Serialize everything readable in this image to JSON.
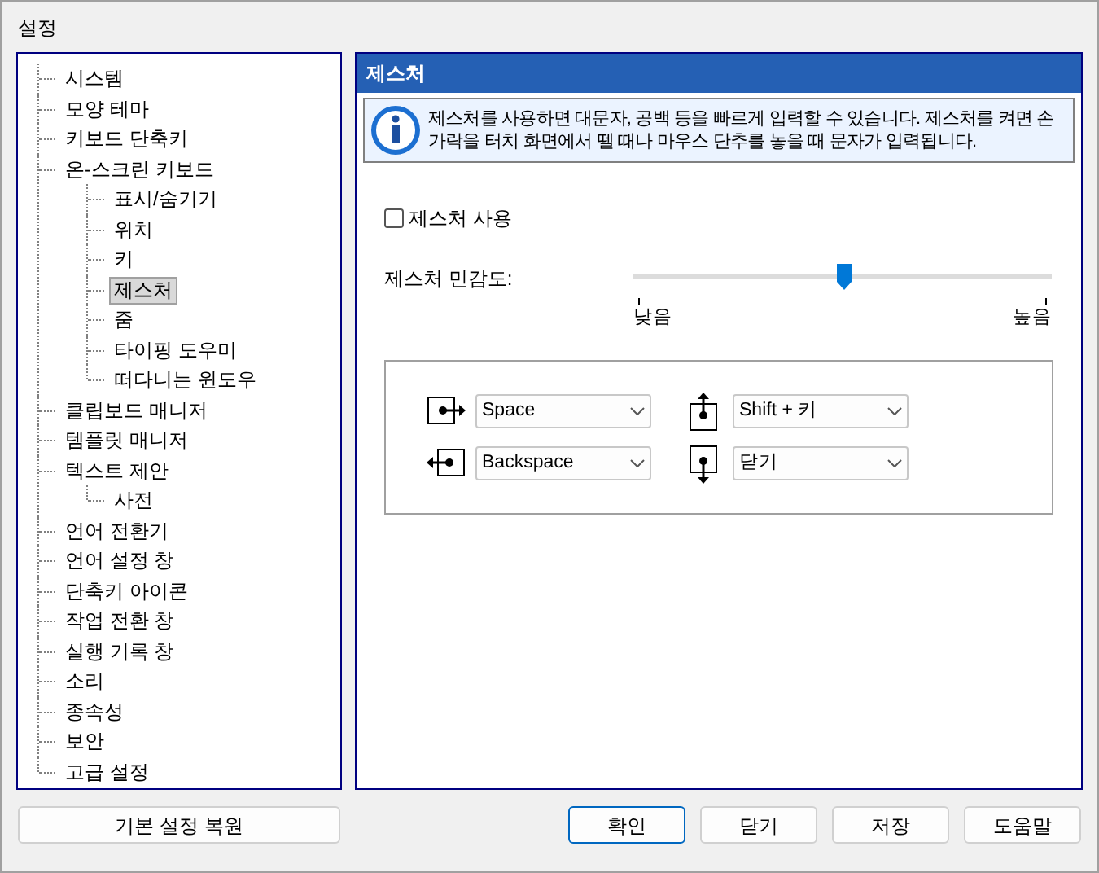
{
  "window": {
    "title": "설정"
  },
  "tree": [
    {
      "label": "시스템",
      "selected": false
    },
    {
      "label": "모양 테마",
      "selected": false
    },
    {
      "label": "키보드 단축키",
      "selected": false
    },
    {
      "label": "온-스크린 키보드",
      "selected": false,
      "children": [
        {
          "label": "표시/숨기기",
          "selected": false
        },
        {
          "label": "위치",
          "selected": false
        },
        {
          "label": "키",
          "selected": false
        },
        {
          "label": "제스처",
          "selected": true
        },
        {
          "label": "줌",
          "selected": false
        },
        {
          "label": "타이핑 도우미",
          "selected": false
        },
        {
          "label": "떠다니는 윈도우",
          "selected": false
        }
      ]
    },
    {
      "label": "클립보드 매니저",
      "selected": false
    },
    {
      "label": "템플릿 매니저",
      "selected": false
    },
    {
      "label": "텍스트 제안",
      "selected": false,
      "children": [
        {
          "label": "사전",
          "selected": false
        }
      ]
    },
    {
      "label": "언어 전환기",
      "selected": false
    },
    {
      "label": "언어 설정 창",
      "selected": false
    },
    {
      "label": "단축키 아이콘",
      "selected": false
    },
    {
      "label": "작업 전환 창",
      "selected": false
    },
    {
      "label": "실행 기록 창",
      "selected": false
    },
    {
      "label": "소리",
      "selected": false
    },
    {
      "label": "종속성",
      "selected": false
    },
    {
      "label": "보안",
      "selected": false
    },
    {
      "label": "고급 설정",
      "selected": false
    }
  ],
  "panel": {
    "title": "제스처",
    "info": "제스처를 사용하면 대문자, 공백 등을 빠르게 입력할 수 있습니다. 제스처를 켜면 손가락을 터치 화면에서 뗄 때나 마우스 단추를 놓을 때 문자가 입력됩니다.",
    "enable": {
      "label": "제스처 사용",
      "checked": false
    },
    "sensitivity": {
      "label": "제스처 민감도:",
      "level": 0.5,
      "low": "낮음",
      "high": "높음"
    },
    "gestures": [
      {
        "kind": "right",
        "value": "Space"
      },
      {
        "kind": "up",
        "value": "Shift + 키"
      },
      {
        "kind": "left",
        "value": "Backspace"
      },
      {
        "kind": "down",
        "value": "닫기"
      }
    ]
  },
  "reset_button": "기본 설정 복원",
  "buttons": [
    {
      "label": "확인",
      "default": true
    },
    {
      "label": "닫기",
      "default": false
    },
    {
      "label": "저장",
      "default": false
    },
    {
      "label": "도움말",
      "default": false
    }
  ]
}
